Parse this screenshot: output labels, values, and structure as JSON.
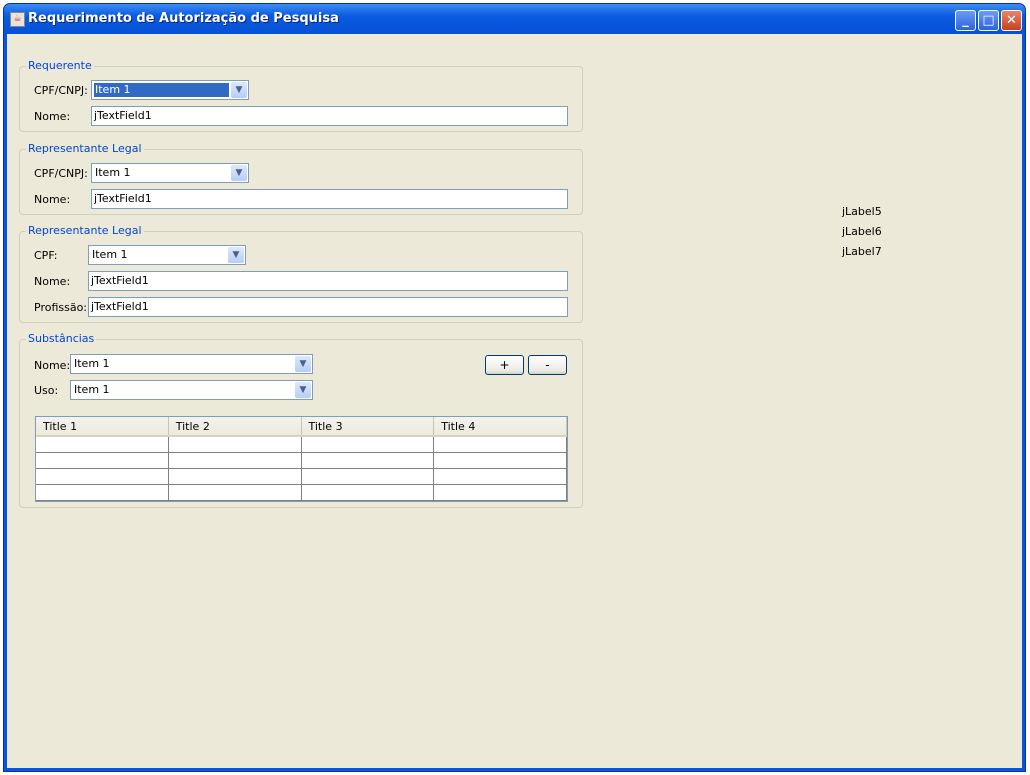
{
  "window": {
    "title": "Requerimento de Autorização de Pesquisa",
    "minimize": "_",
    "maximize": "□",
    "close": "✕"
  },
  "requerente": {
    "title": "Requerente",
    "cpf_label": "CPF/CNPJ:",
    "cpf_value": "Item 1",
    "nome_label": "Nome:",
    "nome_value": "jTextField1"
  },
  "representante1": {
    "title": "Representante Legal",
    "cpf_label": "CPF/CNPJ:",
    "cpf_value": "Item 1",
    "nome_label": "Nome:",
    "nome_value": "jTextField1"
  },
  "representante2": {
    "title": "Representante Legal",
    "cpf_label": "CPF:",
    "cpf_value": "Item 1",
    "nome_label": "Nome:",
    "nome_value": "jTextField1",
    "profissao_label": "Profissão:",
    "profissao_value": "jTextField1"
  },
  "substancias": {
    "title": "Substâncias",
    "nome_label": "Nome:",
    "nome_value": "Item 1",
    "uso_label": "Uso:",
    "uso_value": "Item 1",
    "add": "+",
    "remove": "-",
    "columns": [
      "Title 1",
      "Title 2",
      "Title 3",
      "Title 4"
    ]
  },
  "labels": [
    "jLabel5",
    "jLabel6",
    "jLabel7"
  ]
}
